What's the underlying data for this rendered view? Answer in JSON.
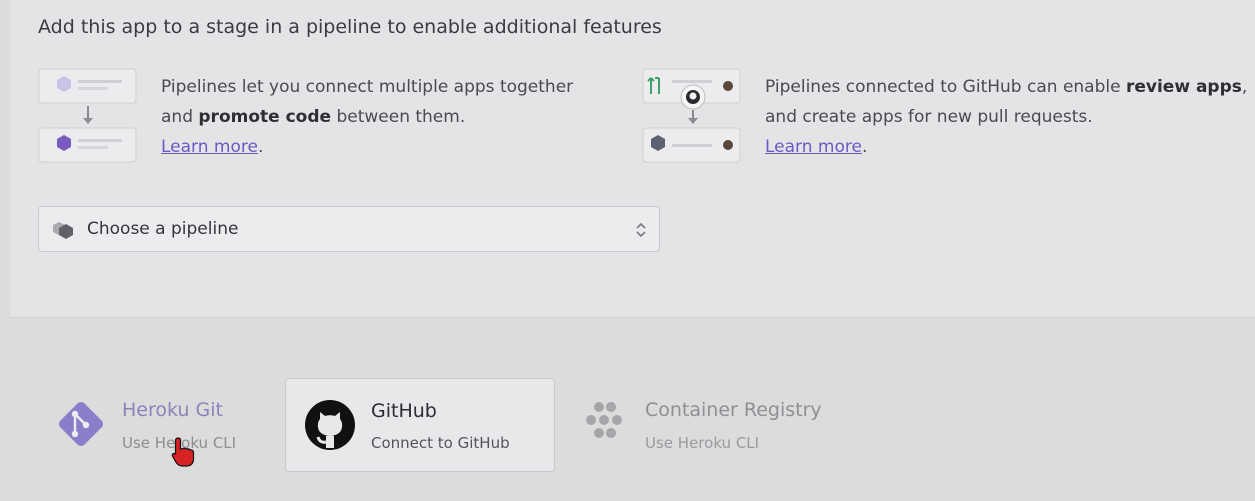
{
  "pipeline": {
    "heading": "Add this app to a stage in a pipeline to enable additional features",
    "features": [
      {
        "text_before": "Pipelines let you connect multiple apps together and ",
        "bold": "promote code",
        "text_after": " between them.",
        "link": "Learn more",
        "link_suffix": "."
      },
      {
        "text_before": "Pipelines connected to GitHub can enable ",
        "bold": "review apps",
        "text_after": ", and create apps for new pull requests.",
        "link": "Learn more",
        "link_suffix": "."
      }
    ],
    "select": {
      "label": "Choose a pipeline",
      "icon": "pipeline-icon"
    }
  },
  "deploy_methods": [
    {
      "title": "Heroku Git",
      "subtitle": "Use Heroku CLI",
      "icon": "heroku-git-icon"
    },
    {
      "title": "GitHub",
      "subtitle": "Connect to GitHub",
      "icon": "github-icon",
      "selected": true
    },
    {
      "title": "Container Registry",
      "subtitle": "Use Heroku CLI",
      "icon": "container-registry-icon"
    }
  ],
  "colors": {
    "accent": "#6b59c4",
    "heroku_purple": "#8a7dc9",
    "panel_bg": "#e4e4e6",
    "page_bg": "#dcdcdc"
  }
}
